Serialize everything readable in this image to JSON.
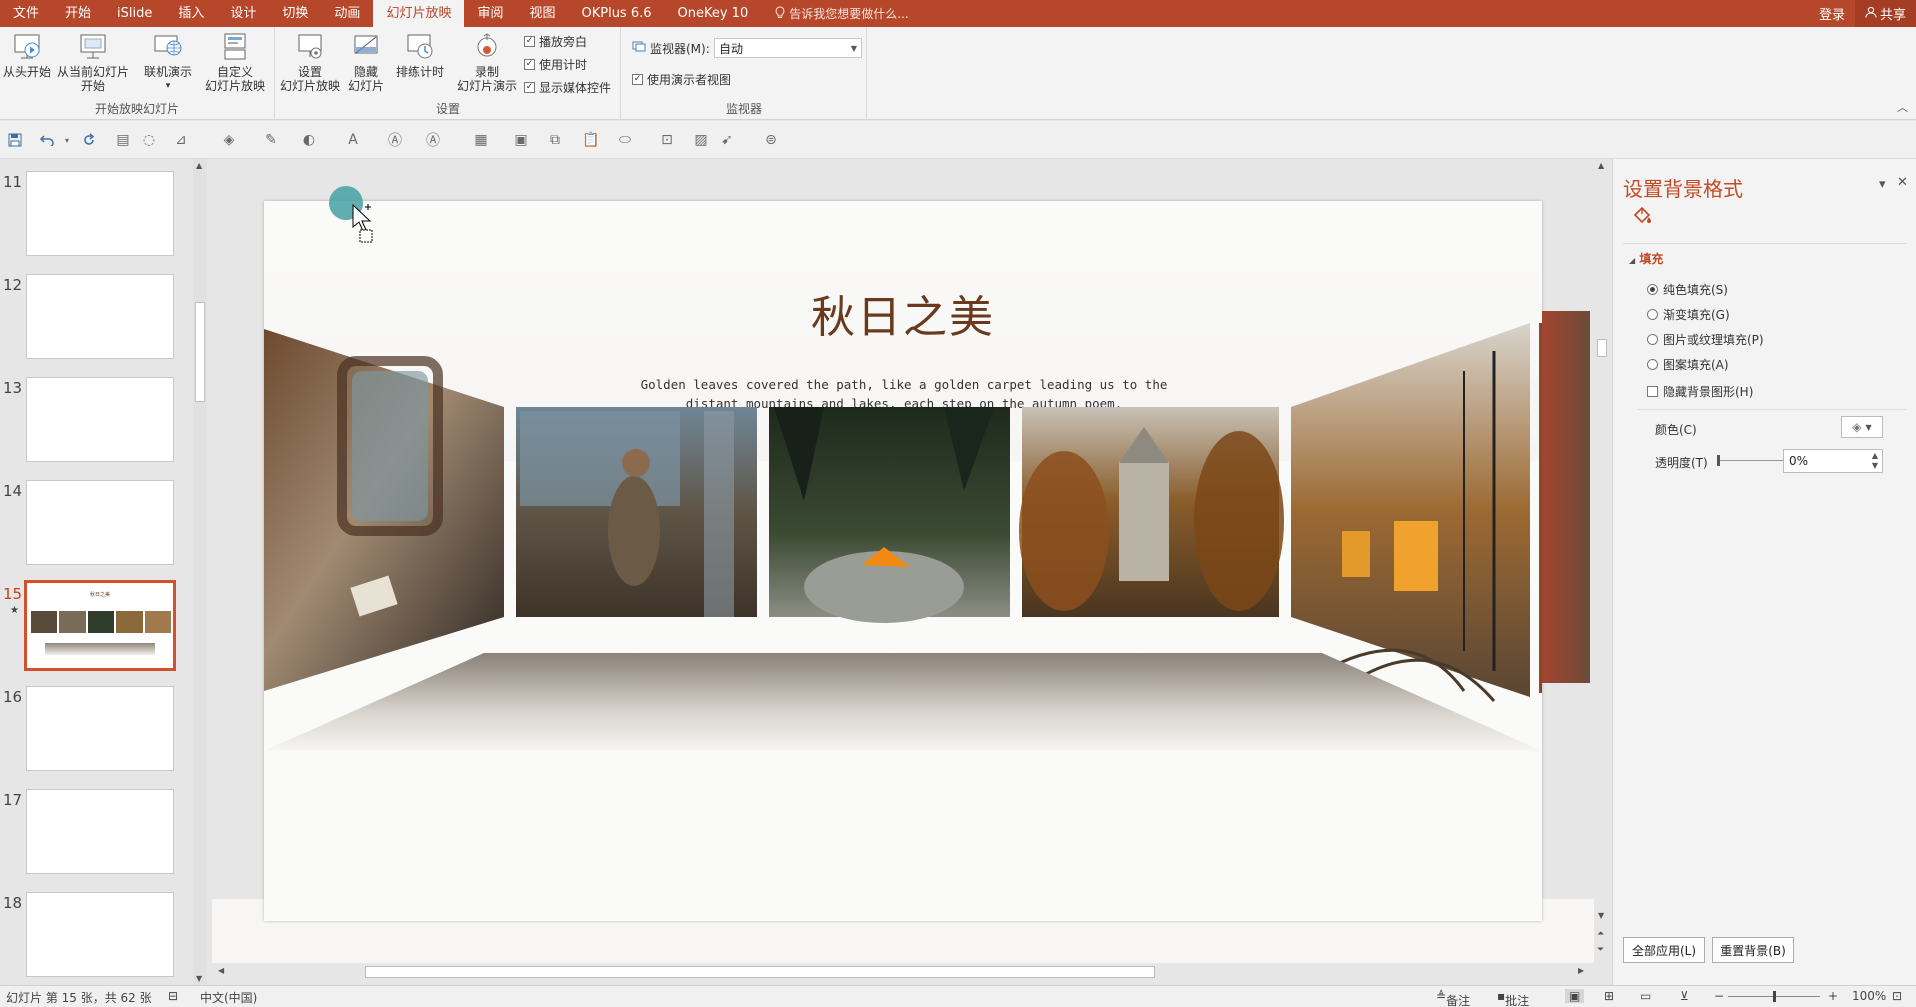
{
  "tabs": [
    "文件",
    "开始",
    "iSlide",
    "插入",
    "设计",
    "切换",
    "动画",
    "幻灯片放映",
    "审阅",
    "视图",
    "OKPlus 6.6",
    "OneKey 10"
  ],
  "active_tab": "幻灯片放映",
  "tell_me": "告诉我您想要做什么...",
  "login": "登录",
  "share": "共享",
  "ribbon": {
    "start_group": {
      "label": "开始放映幻灯片",
      "from_beginning": "从头开始",
      "from_current_1": "从当前幻灯片",
      "from_current_2": "开始",
      "online": "联机演示",
      "custom_1": "自定义",
      "custom_2": "幻灯片放映"
    },
    "setup_group": {
      "label": "设置",
      "setup_1": "设置",
      "setup_2": "幻灯片放映",
      "hide_1": "隐藏",
      "hide_2": "幻灯片",
      "rehearse": "排练计时",
      "record_1": "录制",
      "record_2": "幻灯片演示",
      "play_narration": "播放旁白",
      "use_timings": "使用计时",
      "show_media": "显示媒体控件"
    },
    "monitor_group": {
      "label": "监视器",
      "monitor_label": "监视器(M):",
      "monitor_value": "自动",
      "presenter_view": "使用演示者视图"
    }
  },
  "thumbnails": [
    {
      "num": "11"
    },
    {
      "num": "12"
    },
    {
      "num": "13"
    },
    {
      "num": "14"
    },
    {
      "num": "15",
      "selected": true,
      "thumb_title": "秋日之美"
    },
    {
      "num": "16"
    },
    {
      "num": "17"
    },
    {
      "num": "18"
    }
  ],
  "slide": {
    "title": "秋日之美",
    "subtitle_1": "Golden leaves covered the path, like a golden carpet leading us to the",
    "subtitle_2": "distant mountains and lakes, each step on the autumn poem."
  },
  "pane": {
    "title": "设置背景格式",
    "section": "填充",
    "options": [
      "纯色填充(S)",
      "渐变填充(G)",
      "图片或纹理填充(P)",
      "图案填充(A)"
    ],
    "selected_option": "纯色填充(S)",
    "hide_bg": "隐藏背景图形(H)",
    "color_label": "颜色(C)",
    "transparency_label": "透明度(T)",
    "transparency_value": "0%",
    "apply_all": "全部应用(L)",
    "reset_bg": "重置背景(B)"
  },
  "status": {
    "slide_info": "幻灯片 第 15 张，共 62 张",
    "language": "中文(中国)",
    "notes": "备注",
    "comments": "批注",
    "zoom": "100%"
  },
  "colors": {
    "accent": "#b7472a",
    "pane_title": "#c24a26",
    "slide_title": "#6b3a1e"
  }
}
